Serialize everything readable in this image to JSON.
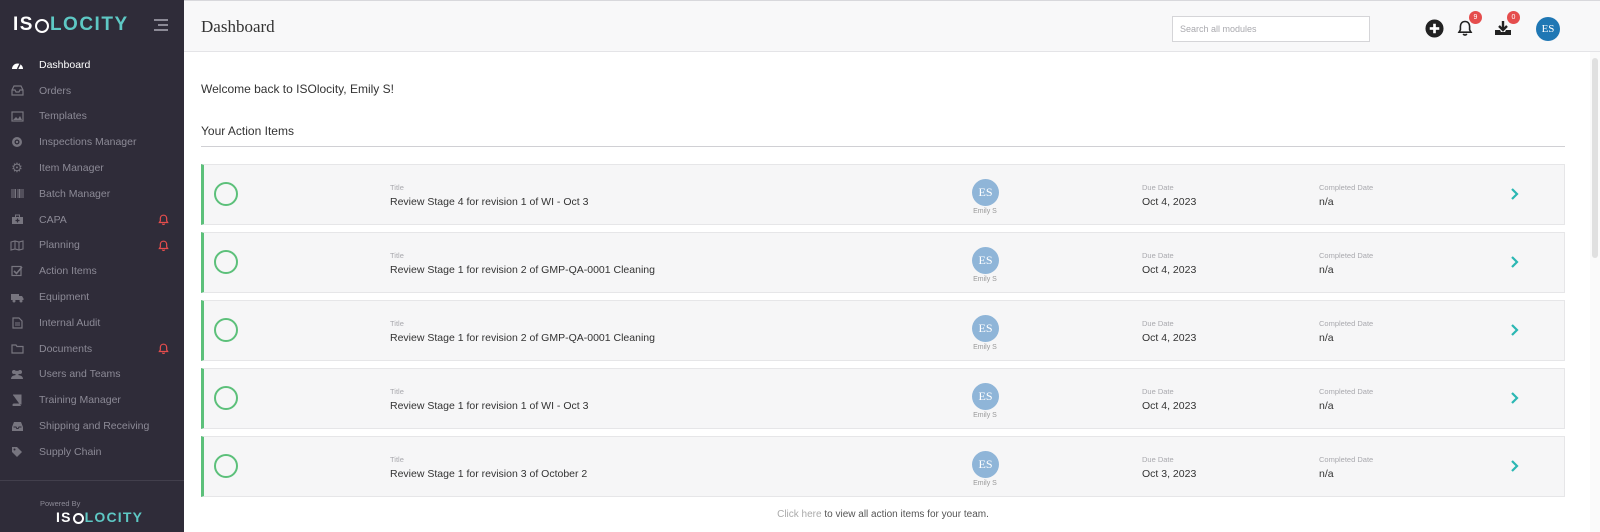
{
  "brand": {
    "iso": "IS",
    "locity": "LOCITY",
    "powered_by": "Powered By"
  },
  "sidebar": {
    "items": [
      {
        "label": "Dashboard",
        "icon": "dashboard-icon",
        "active": true,
        "alert": false
      },
      {
        "label": "Orders",
        "icon": "inbox-icon",
        "active": false,
        "alert": false
      },
      {
        "label": "Templates",
        "icon": "image-icon",
        "active": false,
        "alert": false
      },
      {
        "label": "Inspections Manager",
        "icon": "target-icon",
        "active": false,
        "alert": false
      },
      {
        "label": "Item Manager",
        "icon": "gear-icon",
        "active": false,
        "alert": false
      },
      {
        "label": "Batch Manager",
        "icon": "barcode-icon",
        "active": false,
        "alert": false
      },
      {
        "label": "CAPA",
        "icon": "medkit-icon",
        "active": false,
        "alert": true
      },
      {
        "label": "Planning",
        "icon": "map-icon",
        "active": false,
        "alert": true
      },
      {
        "label": "Action Items",
        "icon": "checkbox-icon",
        "active": false,
        "alert": false
      },
      {
        "label": "Equipment",
        "icon": "truck-icon",
        "active": false,
        "alert": false
      },
      {
        "label": "Internal Audit",
        "icon": "file-icon",
        "active": false,
        "alert": false
      },
      {
        "label": "Documents",
        "icon": "folder-icon",
        "active": false,
        "alert": true
      },
      {
        "label": "Users and Teams",
        "icon": "users-icon",
        "active": false,
        "alert": false
      },
      {
        "label": "Training Manager",
        "icon": "book-icon",
        "active": false,
        "alert": false
      },
      {
        "label": "Shipping and Receiving",
        "icon": "tray-icon",
        "active": false,
        "alert": false
      },
      {
        "label": "Supply Chain",
        "icon": "tag-icon",
        "active": false,
        "alert": false
      }
    ]
  },
  "header": {
    "title": "Dashboard",
    "search_placeholder": "Search all modules",
    "notifications_count": "9",
    "downloads_count": "0",
    "user_initials": "ES"
  },
  "main": {
    "welcome": "Welcome back to ISOlocity, Emily S!",
    "section_title": "Your Action Items",
    "labels": {
      "title": "Title",
      "due": "Due Date",
      "completed": "Completed Date"
    },
    "items": [
      {
        "title": "Review Stage 4 for revision 1 of WI - Oct 3",
        "initials": "ES",
        "assignee": "Emily S",
        "due": "Oct 4, 2023",
        "completed": "n/a"
      },
      {
        "title": "Review Stage 1 for revision 2 of GMP-QA-0001 Cleaning",
        "initials": "ES",
        "assignee": "Emily S",
        "due": "Oct 4, 2023",
        "completed": "n/a"
      },
      {
        "title": "Review Stage 1 for revision 2 of GMP-QA-0001 Cleaning",
        "initials": "ES",
        "assignee": "Emily S",
        "due": "Oct 4, 2023",
        "completed": "n/a"
      },
      {
        "title": "Review Stage 1 for revision 1 of WI - Oct 3",
        "initials": "ES",
        "assignee": "Emily S",
        "due": "Oct 4, 2023",
        "completed": "n/a"
      },
      {
        "title": "Review Stage 1 for revision 3 of October 2",
        "initials": "ES",
        "assignee": "Emily S",
        "due": "Oct 3, 2023",
        "completed": "n/a"
      }
    ],
    "footer_link": "Click here",
    "footer_text": " to view all action items for your team."
  },
  "colors": {
    "sidebar_bg": "#2f2c39",
    "accent_teal": "#5ec8c4",
    "check_green": "#5cc07a",
    "badge_red": "#e54d4d",
    "avatar_blue": "#1f77b4"
  }
}
